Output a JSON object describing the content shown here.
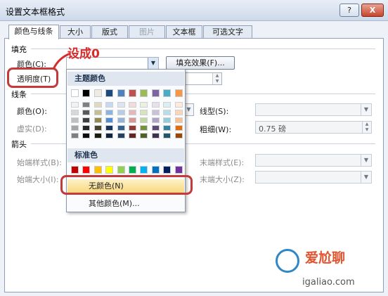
{
  "window": {
    "title": "设置文本框格式",
    "help_label": "?",
    "close_label": "X"
  },
  "tabs": [
    {
      "label": "颜色与线条"
    },
    {
      "label": "大小"
    },
    {
      "label": "版式"
    },
    {
      "label": "图片"
    },
    {
      "label": "文本框"
    },
    {
      "label": "可选文字"
    }
  ],
  "fill": {
    "section": "填充",
    "color_label": "颜色(C):",
    "fill_effects_button": "填充效果(F)...",
    "transparency_label": "透明度(T)"
  },
  "line": {
    "section": "线条",
    "color_label": "颜色(O):",
    "dash_label": "虚实(D):",
    "style_label": "线型(S):",
    "weight_label": "粗细(W):",
    "weight_value": "0.75 磅"
  },
  "arrows": {
    "section": "箭头",
    "begin_style_label": "始端样式(B):",
    "end_style_label": "末端样式(E):",
    "begin_size_label": "始端大小(I):",
    "end_size_label": "末端大小(Z):"
  },
  "color_popup": {
    "theme_header": "主题颜色",
    "standard_header": "标准色",
    "no_color": "无颜色(N)",
    "more_colors": "其他颜色(M)...",
    "theme_colors": [
      "#ffffff",
      "#000000",
      "#eeece1",
      "#1f497d",
      "#4f81bd",
      "#c0504d",
      "#9bbb59",
      "#8064a2",
      "#4bacc6",
      "#f79646"
    ],
    "theme_shades": [
      [
        "#f2f2f2",
        "#d8d8d8",
        "#bfbfbf",
        "#a5a5a5",
        "#7f7f7f"
      ],
      [
        "#7f7f7f",
        "#595959",
        "#3f3f3f",
        "#262626",
        "#0c0c0c"
      ],
      [
        "#ddd9c3",
        "#c4bd97",
        "#938953",
        "#494429",
        "#1d1b10"
      ],
      [
        "#c6d9f0",
        "#8db3e2",
        "#548dd4",
        "#17365d",
        "#0f243e"
      ],
      [
        "#dbe5f1",
        "#b8cce4",
        "#95b3d7",
        "#366092",
        "#244061"
      ],
      [
        "#f2dcdb",
        "#e5b9b7",
        "#d99694",
        "#953734",
        "#632423"
      ],
      [
        "#ebf1dd",
        "#d7e3bc",
        "#c3d69b",
        "#76923c",
        "#4f6128"
      ],
      [
        "#e5e0ec",
        "#ccc1d9",
        "#b2a2c7",
        "#5f497a",
        "#3f3151"
      ],
      [
        "#dbeef3",
        "#b7dde8",
        "#92cddc",
        "#31859b",
        "#205867"
      ],
      [
        "#fdeada",
        "#fbd5b5",
        "#fac08f",
        "#e36c09",
        "#974806"
      ]
    ],
    "standard_colors": [
      "#c00000",
      "#ff0000",
      "#ffc000",
      "#ffff00",
      "#92d050",
      "#00b050",
      "#00b0f0",
      "#0070c0",
      "#002060",
      "#7030a0"
    ]
  },
  "annotation": {
    "text": "设成0",
    "color": "#d82b2b"
  },
  "watermark": {
    "text_1": "爱尬聊",
    "text_2": "igaliao.com"
  },
  "colors": {
    "accent": "#2f87c8",
    "highlight": "#f7d77b"
  }
}
